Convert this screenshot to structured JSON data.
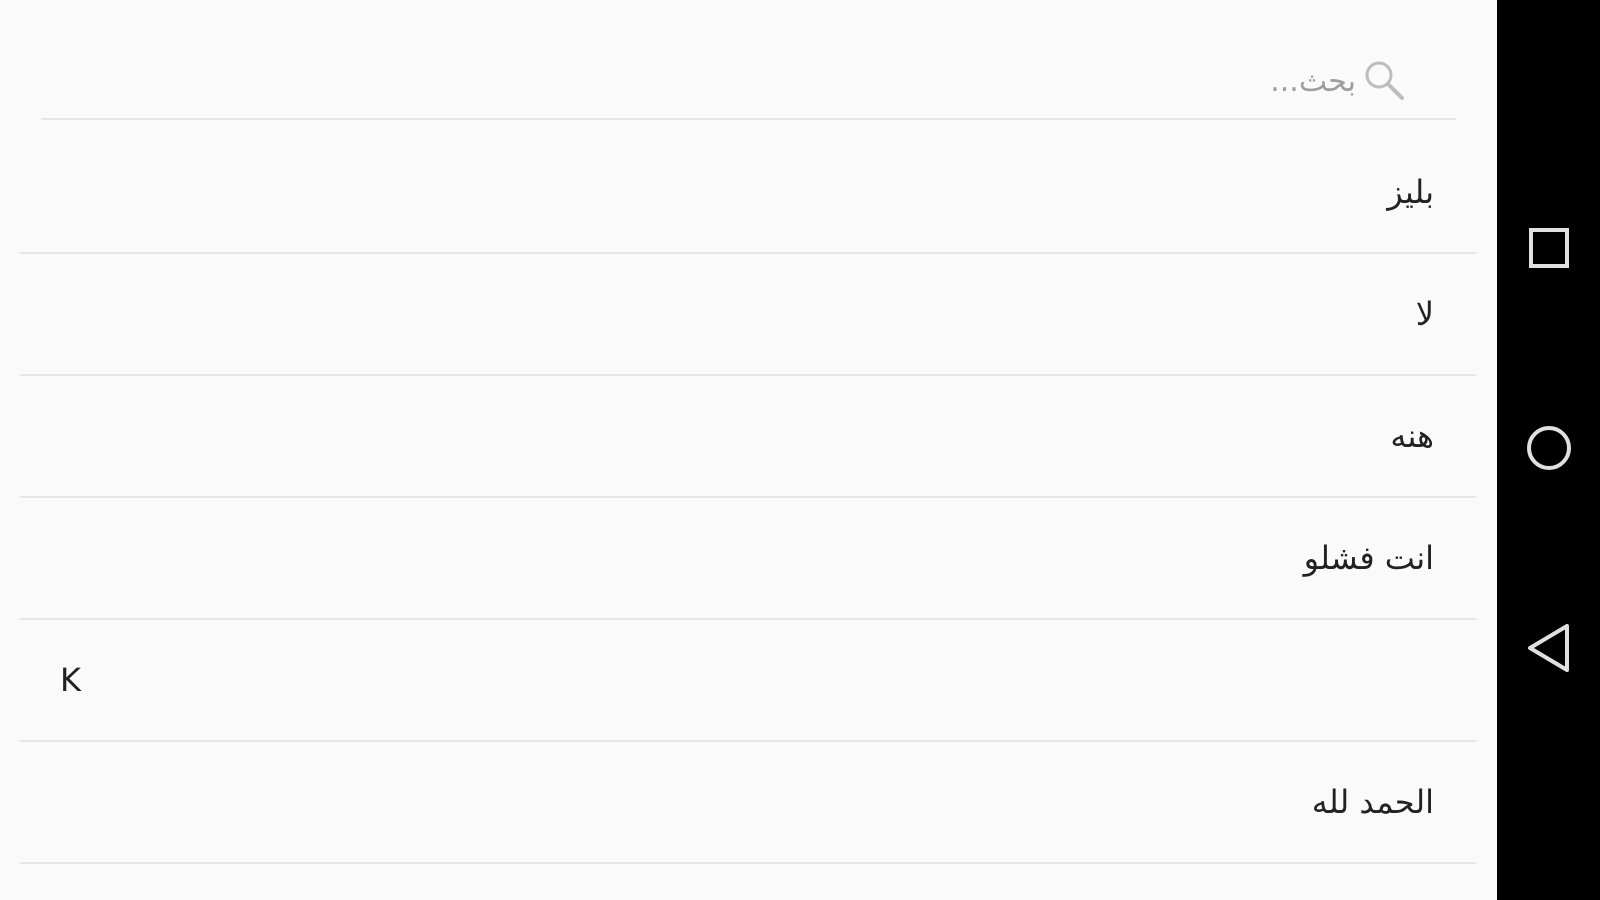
{
  "search": {
    "placeholder": "بحث...",
    "icon": "search-icon"
  },
  "list": {
    "items": [
      {
        "label": "بليز",
        "dir": "rtl"
      },
      {
        "label": "لا",
        "dir": "rtl"
      },
      {
        "label": "هنه",
        "dir": "rtl"
      },
      {
        "label": "انت فشلو",
        "dir": "rtl"
      },
      {
        "label": "K",
        "dir": "ltr"
      },
      {
        "label": "الحمد لله",
        "dir": "rtl"
      }
    ]
  },
  "navbar": {
    "buttons": [
      {
        "name": "recents",
        "icon": "square-icon"
      },
      {
        "name": "home",
        "icon": "circle-icon"
      },
      {
        "name": "back",
        "icon": "triangle-back-icon"
      }
    ]
  },
  "colors": {
    "background": "#fafafa",
    "divider": "#e6e6e6",
    "navbar": "#000000",
    "text": "#222222",
    "placeholder": "#9e9e9e"
  }
}
